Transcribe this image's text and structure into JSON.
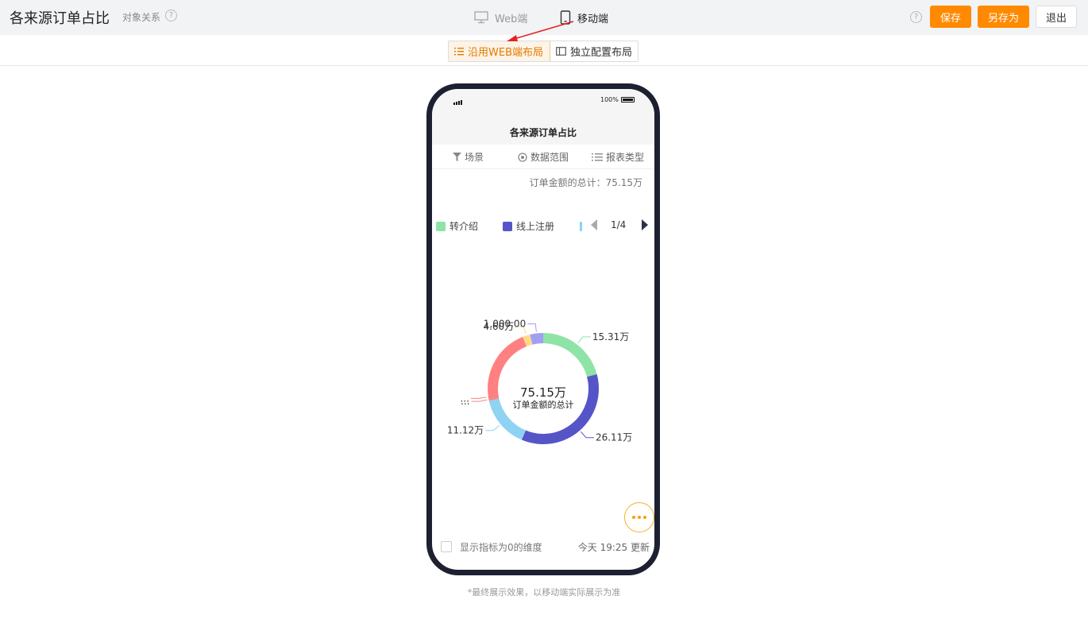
{
  "header": {
    "title": "各来源订单占比",
    "object_relation": "对象关系",
    "help_glyph": "?",
    "tabs": [
      {
        "label": "Web端",
        "icon": "monitor-icon",
        "active": false
      },
      {
        "label": "移动端",
        "icon": "mobile-icon",
        "active": true
      }
    ],
    "buttons": {
      "save": "保存",
      "save_as": "另存为",
      "exit": "退出"
    },
    "accent_color": "#ff8a00"
  },
  "layout_toggle": {
    "options": [
      {
        "label": "沿用WEB端布局",
        "icon": "list-icon",
        "selected": true
      },
      {
        "label": "独立配置布局",
        "icon": "panel-icon",
        "selected": false
      }
    ]
  },
  "phone": {
    "status": {
      "battery": "100%"
    },
    "title": "各来源订单占比",
    "filters": [
      {
        "label": "场景",
        "icon": "filter-icon"
      },
      {
        "label": "数据范围",
        "icon": "range-icon"
      },
      {
        "label": "报表类型",
        "icon": "list-icon"
      }
    ],
    "total_text": "订单金额的总计：75.15万",
    "legend": {
      "items": [
        {
          "label": "转介绍",
          "color": "#8fe3a6"
        },
        {
          "label": "线上注册",
          "color": "#5555c8"
        }
      ],
      "page": "1/4"
    },
    "footer": {
      "checkbox_label": "显示指标为0的维度",
      "updated": "今天 19:25 更新"
    }
  },
  "chart_data": {
    "type": "pie",
    "variant": "donut",
    "center_value": "75.15万",
    "center_label": "订单金额的总计",
    "slices": [
      {
        "value": 15.31,
        "label": "15.31万",
        "color": "#8fe3a6"
      },
      {
        "value": 26.11,
        "label": "26.11万",
        "color": "#5555c8"
      },
      {
        "value": 11.12,
        "label": "11.12万",
        "color": "#8fd3f2"
      },
      {
        "value": 0.6,
        "label": "...",
        "color": "#f08a8a"
      },
      {
        "value": 0.5,
        "label": "...",
        "color": "#ff7a7a"
      },
      {
        "value": 15.5,
        "label": "",
        "color": "#ff8080"
      },
      {
        "value": 1.6,
        "label": "4.60万",
        "color": "#ffd98a"
      },
      {
        "value": 2.8,
        "label": "1,000.00",
        "color": "#9f9ff5"
      }
    ]
  },
  "bottom_note": "*最终展示效果，以移动端实际展示为准"
}
